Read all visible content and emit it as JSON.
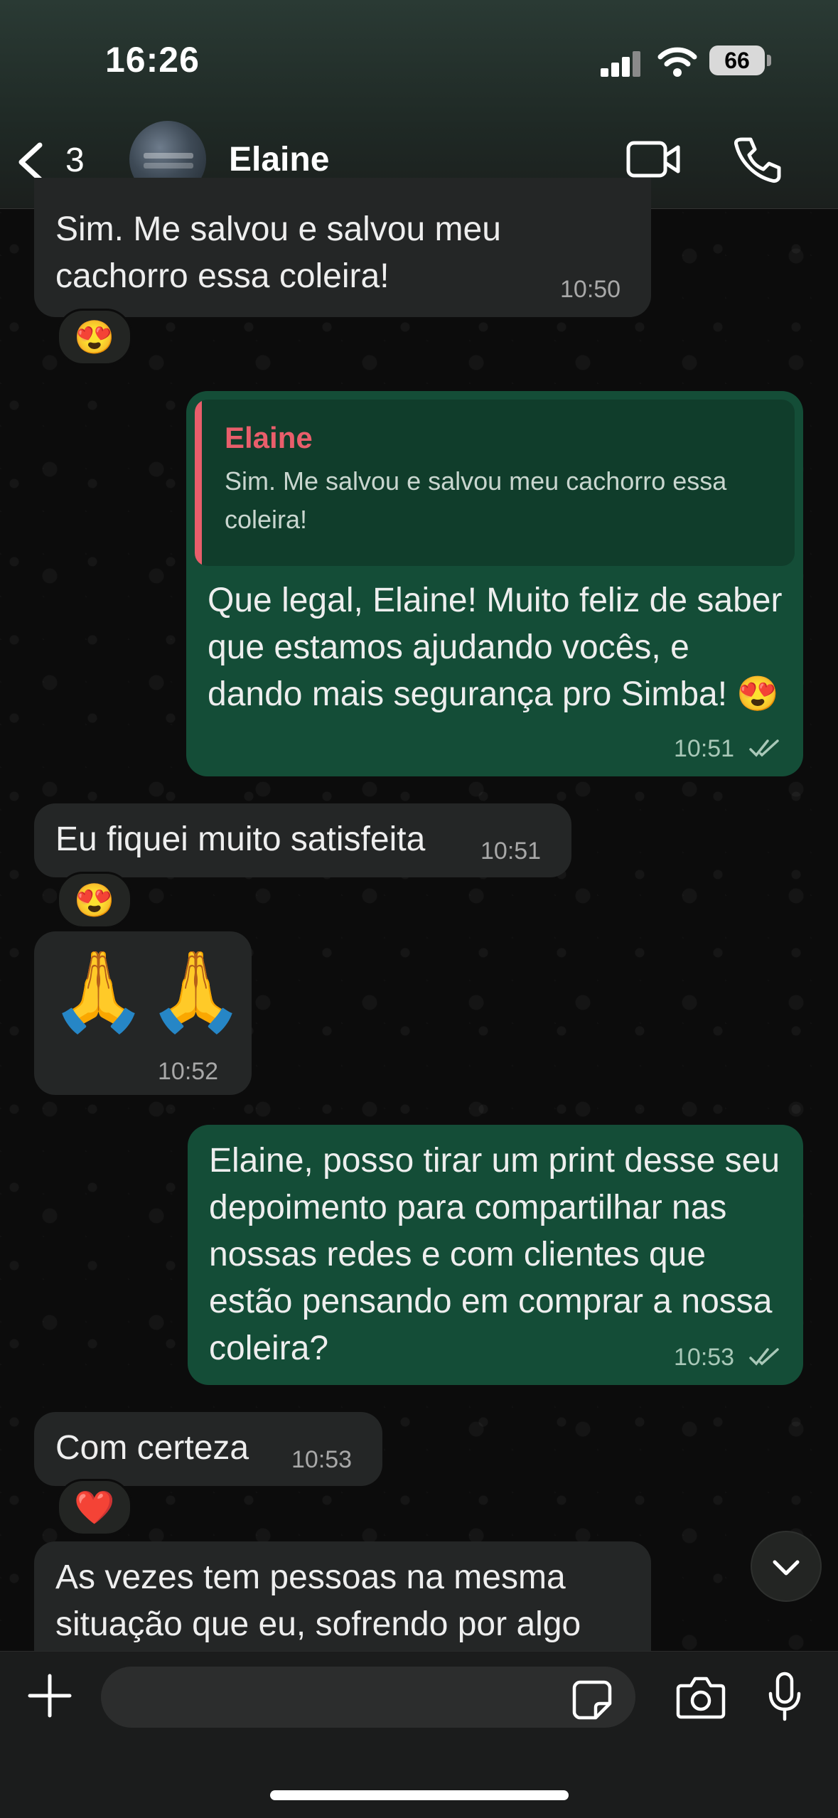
{
  "status_bar": {
    "time": "16:26",
    "battery": "66"
  },
  "header": {
    "back_count": "3",
    "contact_name": "Elaine"
  },
  "messages": [
    {
      "text": "Sim. Me salvou e salvou meu cachorro essa coleira!",
      "time": "10:50",
      "reaction": "😍"
    },
    {
      "quote_author": "Elaine",
      "quote_text": "Sim. Me salvou e salvou meu cachorro essa coleira!",
      "text": "Que legal, Elaine! Muito feliz de saber que estamos ajudando vocês, e dando mais segurança pro Simba! 😍",
      "time": "10:51"
    },
    {
      "text": "Eu fiquei muito satisfeita",
      "time": "10:51",
      "reaction": "😍"
    },
    {
      "text": "🙏🙏",
      "time": "10:52"
    },
    {
      "text": "Elaine, posso tirar um print desse seu depoimento para compartilhar nas nossas redes e com clientes que estão pensando em comprar a nossa coleira?",
      "time": "10:53"
    },
    {
      "text": "Com certeza",
      "time": "10:53",
      "reaction": "❤️"
    },
    {
      "text": "As vezes tem pessoas na mesma situação que eu, sofrendo por algo"
    }
  ],
  "input": {
    "value": ""
  },
  "icons": {
    "back": "chevron-left-icon",
    "video": "video-camera-icon",
    "call": "phone-icon",
    "plus": "plus-icon",
    "sticker": "sticker-icon",
    "camera": "camera-icon",
    "mic": "microphone-icon",
    "scroll": "chevron-down-icon",
    "read": "double-check-icon"
  },
  "colors": {
    "incoming": "#242626",
    "outgoing": "#144d37",
    "quote_accent": "#e95e6b"
  }
}
